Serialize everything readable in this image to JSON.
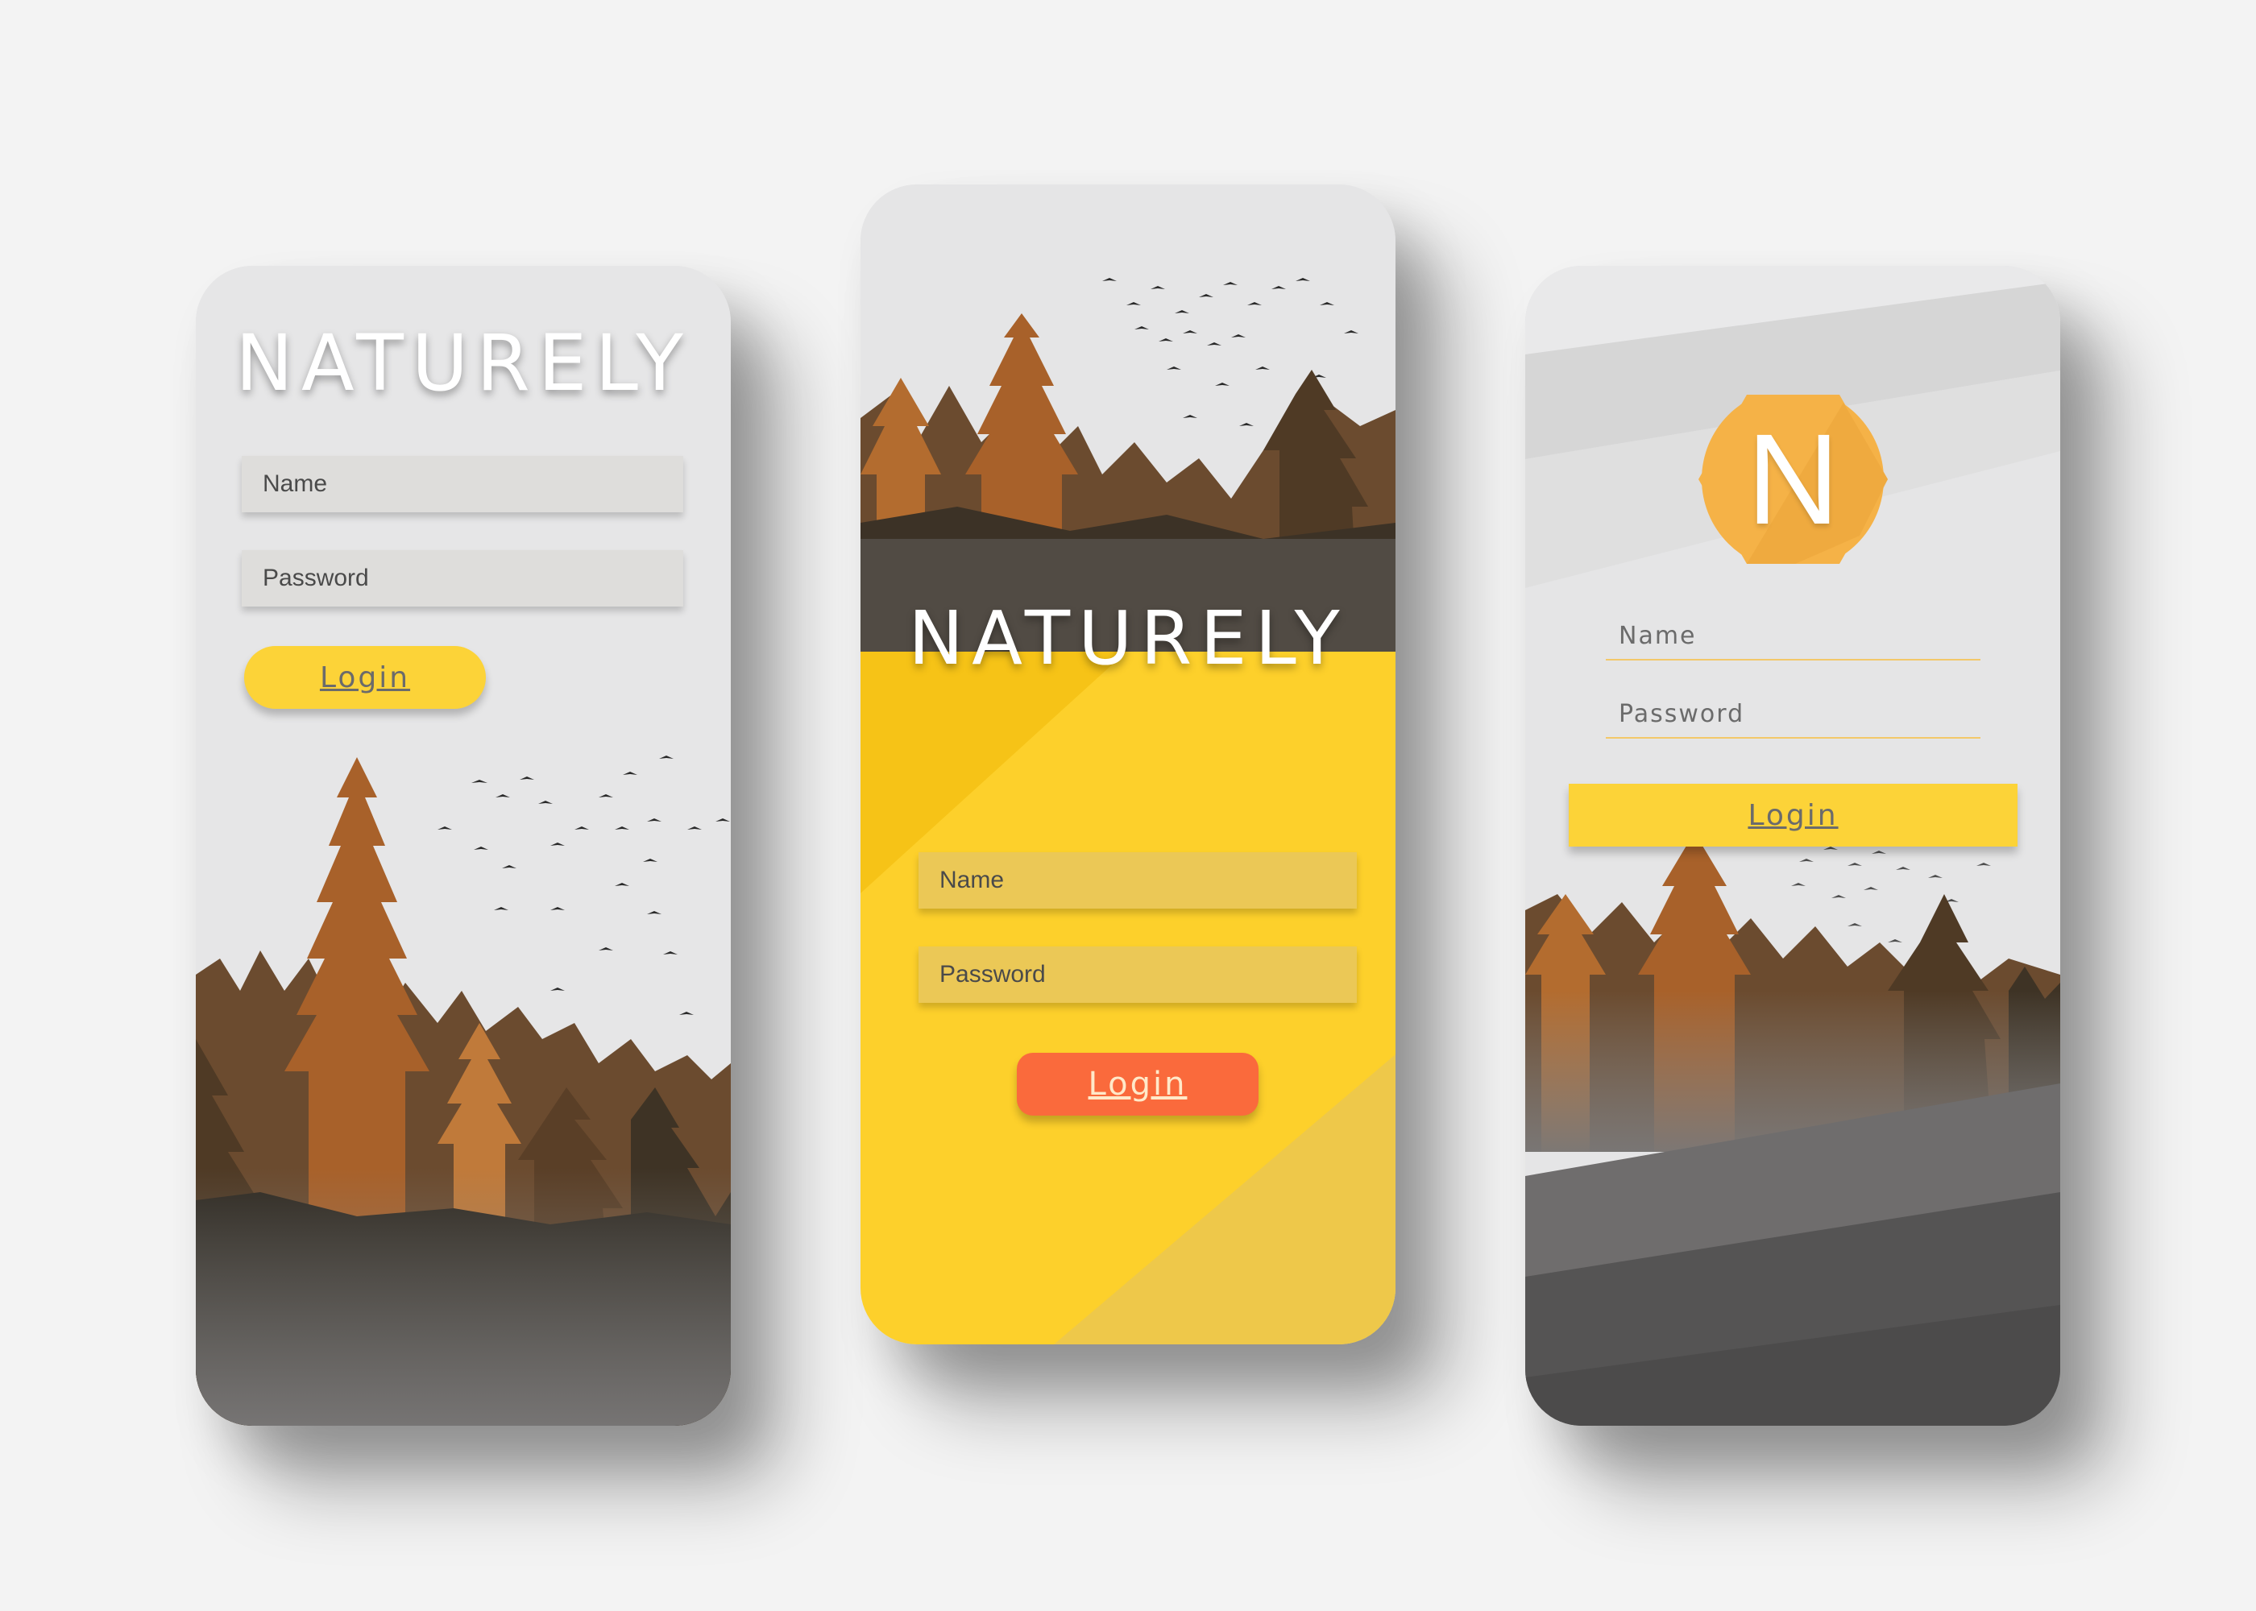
{
  "colors": {
    "background": "#f3f3f3",
    "accent_yellow": "#fdd02b",
    "accent_orange": "#fa6a3c",
    "logo_orange": "#f5b247"
  },
  "screens": [
    {
      "brand": "NATURELY",
      "name_placeholder": "Name",
      "password_placeholder": "Password",
      "login_label": "Login"
    },
    {
      "brand": "NATURELY",
      "name_placeholder": "Name",
      "password_placeholder": "Password",
      "login_label": "Login"
    },
    {
      "logo_letter": "N",
      "name_placeholder": "Name",
      "password_placeholder": "Password",
      "login_label": "Login"
    }
  ]
}
